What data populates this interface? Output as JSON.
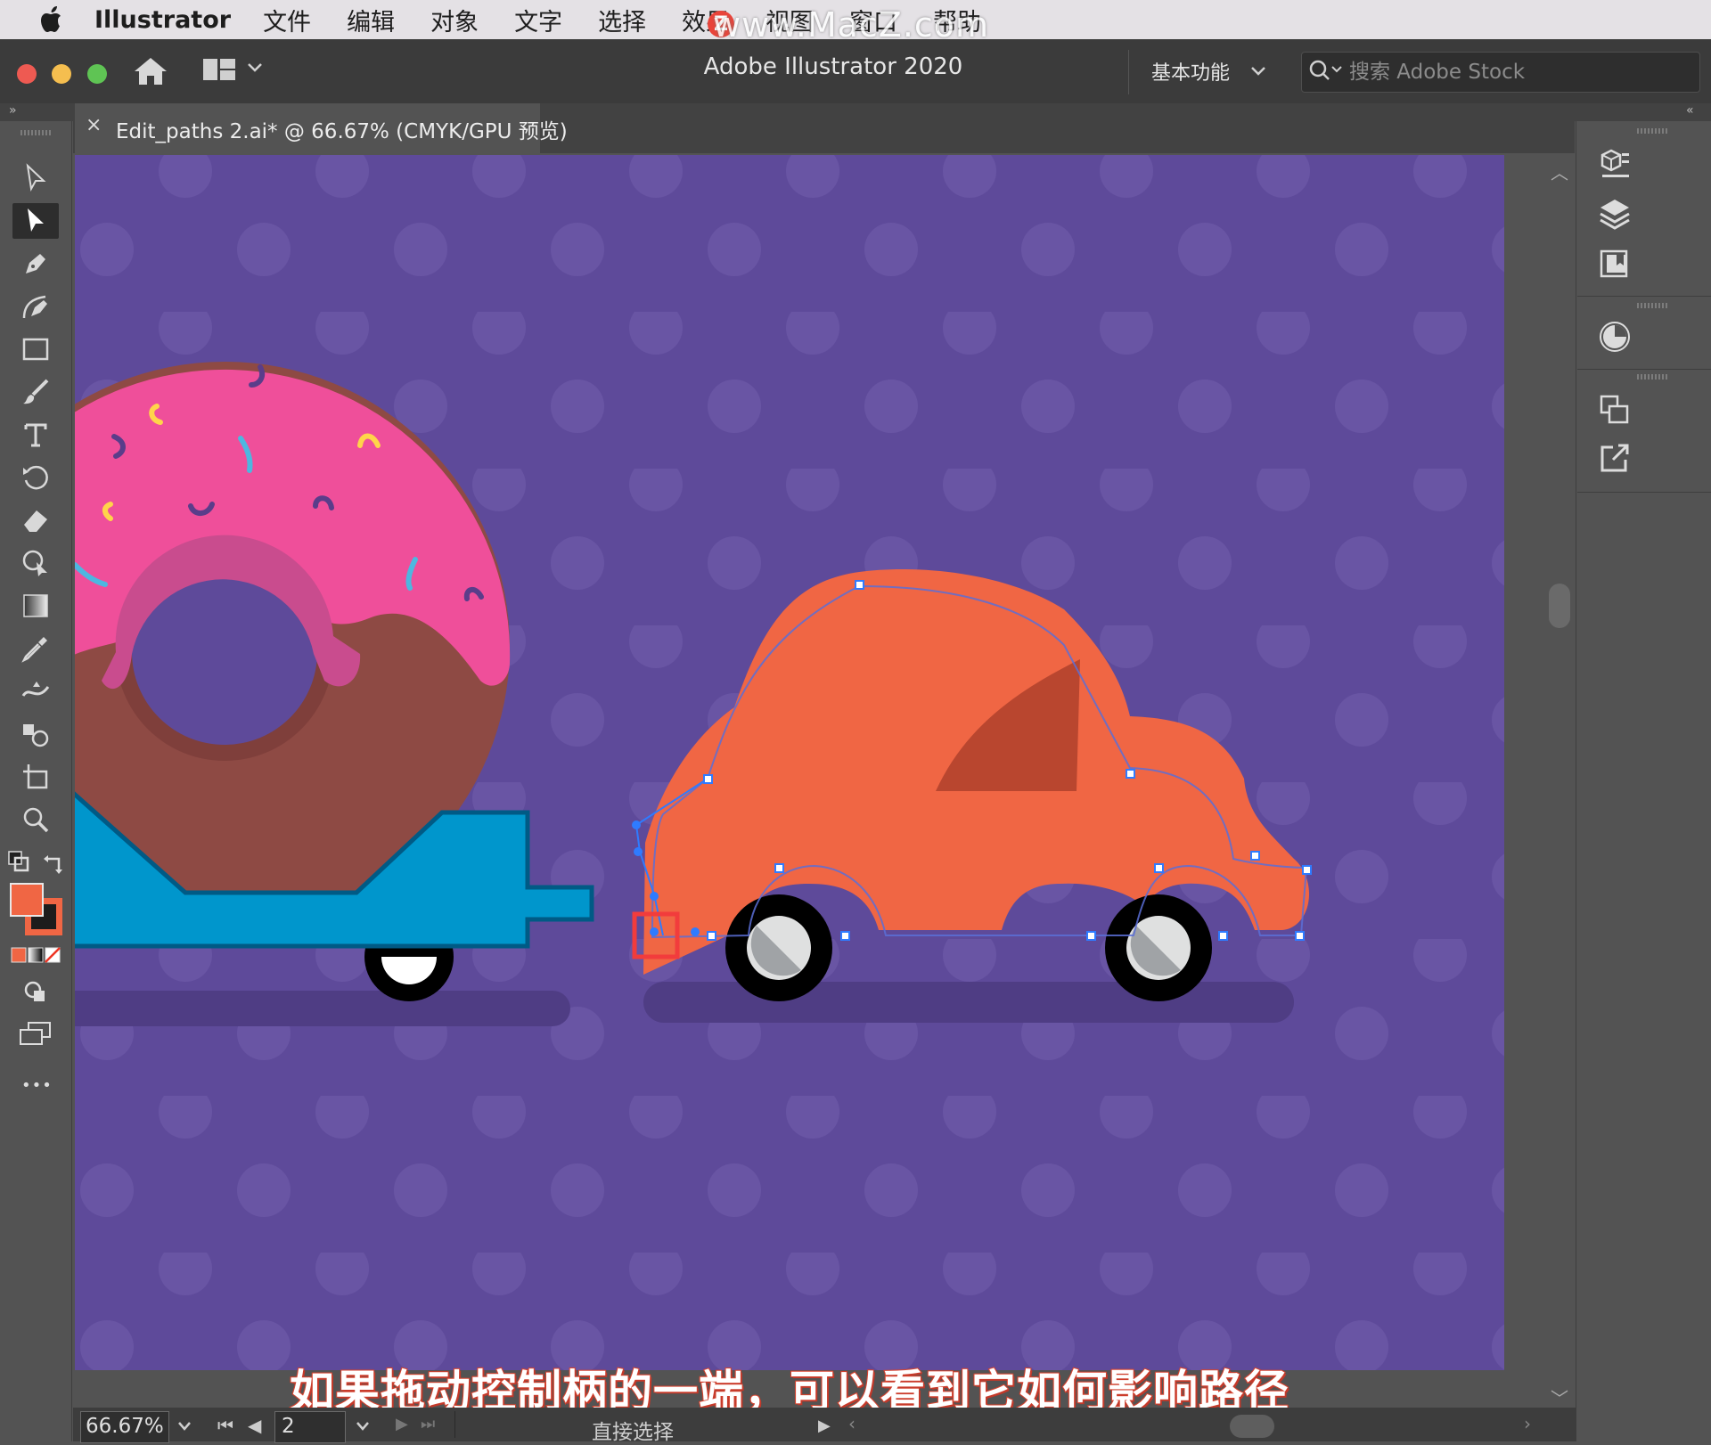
{
  "menubar": {
    "app_name": "Illustrator",
    "items": [
      "文件",
      "编辑",
      "对象",
      "文字",
      "选择",
      "效果",
      "视图",
      "窗口",
      "帮助"
    ],
    "watermark": "www.MacZ.com",
    "watermark_badge": "Z"
  },
  "titlebar": {
    "title": "Adobe Illustrator 2020",
    "workspace": "基本功能",
    "search_placeholder": "搜索 Adobe Stock"
  },
  "document": {
    "tab_title": "Edit_paths 2.ai* @ 66.67% (CMYK/GPU 预览)",
    "close_glyph": "×"
  },
  "artwork": {
    "artboard_color": "#5e4a9a",
    "car_color": "#f06644",
    "trailer_color": "#0096cc",
    "frosting_color": "#ef4f9a",
    "chocolate_color": "#8e4a44",
    "selection_color": "#2f7bff",
    "highlight_color": "#f23c3c"
  },
  "subtitle": "如果拖动控制柄的一端，可以看到它如何影响路径",
  "tools": [
    "selection-tool",
    "direct-selection-tool",
    "pen-tool",
    "curvature-tool",
    "rectangle-tool",
    "paintbrush-tool",
    "type-tool",
    "rotate-tool",
    "eraser-tool",
    "shape-builder-tool",
    "gradient-tool",
    "eyedropper-tool",
    "width-tool",
    "symbol-sprayer-tool",
    "artboard-tool",
    "zoom-tool"
  ],
  "colors": {
    "fill": "#f06644",
    "stroke": "#f06644"
  },
  "expand_glyph": "»",
  "collapse_glyph": "«",
  "more_tools_glyph": "•••",
  "statusbar": {
    "zoom": "66.67%",
    "page": "2",
    "current_tool": "直接选择",
    "nav_first": "⏮",
    "nav_prev": "◀",
    "nav_next": "▶",
    "nav_last": "⏭",
    "play": "▶",
    "h_left": "‹",
    "h_right": "›"
  },
  "scroll": {
    "up": "︿",
    "down": "﹀"
  }
}
